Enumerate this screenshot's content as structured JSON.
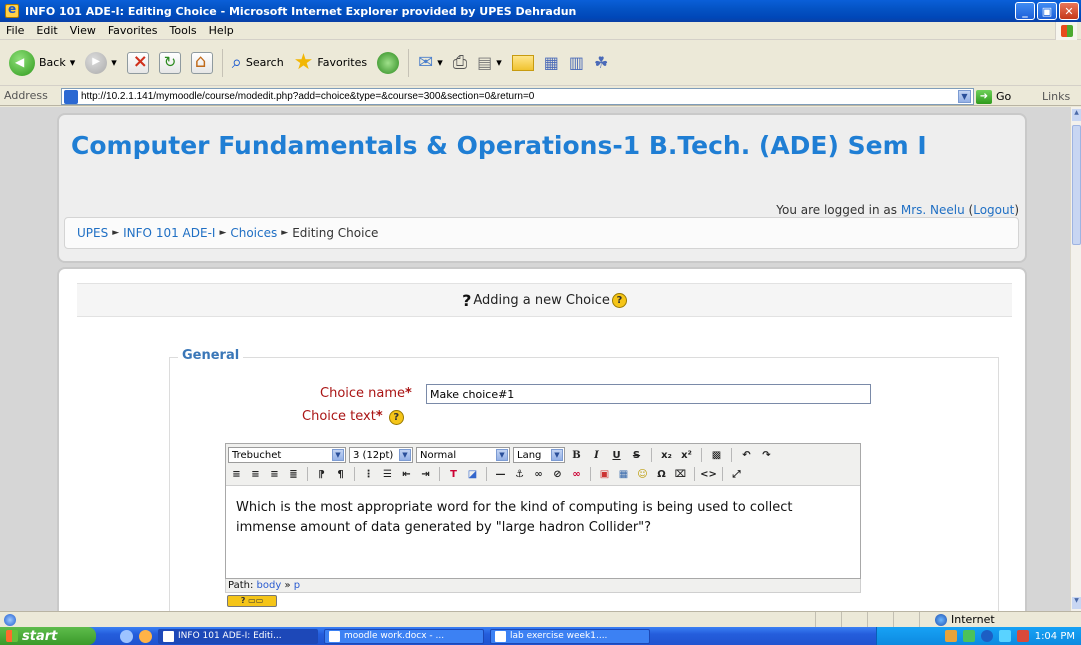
{
  "window": {
    "title": "INFO 101 ADE-I: Editing Choice - Microsoft Internet Explorer provided by UPES Dehradun",
    "minimize": "_",
    "maximize": "▣",
    "close": "✕"
  },
  "menu": [
    "File",
    "Edit",
    "View",
    "Favorites",
    "Tools",
    "Help"
  ],
  "toolbar": {
    "back_label": "Back",
    "search_label": "Search",
    "favorites_label": "Favorites"
  },
  "address": {
    "label": "Address",
    "url": "http://10.2.1.141/mymoodle/course/modedit.php?add=choice&type=&course=300&section=0&return=0",
    "go_label": "Go",
    "links_label": "Links"
  },
  "page": {
    "site_title": "Computer Fundamentals & Operations-1 B.Tech. (ADE) Sem I",
    "login_prefix": "You are logged in as ",
    "login_user": "Mrs. Neelu",
    "logout_label": "Logout",
    "breadcrumb": [
      "UPES",
      "INFO 101 ADE-I",
      "Choices",
      "Editing Choice"
    ],
    "form_heading": "Adding a new Choice",
    "section_legend": "General",
    "choice_name_label": "Choice name",
    "choice_name_value": "Make choice#1",
    "choice_text_label": "Choice text",
    "required_marker": "*"
  },
  "editor": {
    "font_family": "Trebuchet",
    "font_size": "3 (12pt)",
    "format": "Normal",
    "lang": "Lang",
    "body_text": "Which is the most appropriate word for the kind of computing is being used to collect immense amount of data generated by \"large hadron Collider\"?",
    "path_label": "Path:",
    "path_body": "body",
    "path_p": "p"
  },
  "statusbar": {
    "zone": "Internet"
  },
  "taskbar": {
    "start_label": "start",
    "tasks": [
      "INFO 101 ADE-I: Editi...",
      "moodle work.docx - ...",
      "lab exercise week1...."
    ],
    "clock": "1:04 PM"
  }
}
